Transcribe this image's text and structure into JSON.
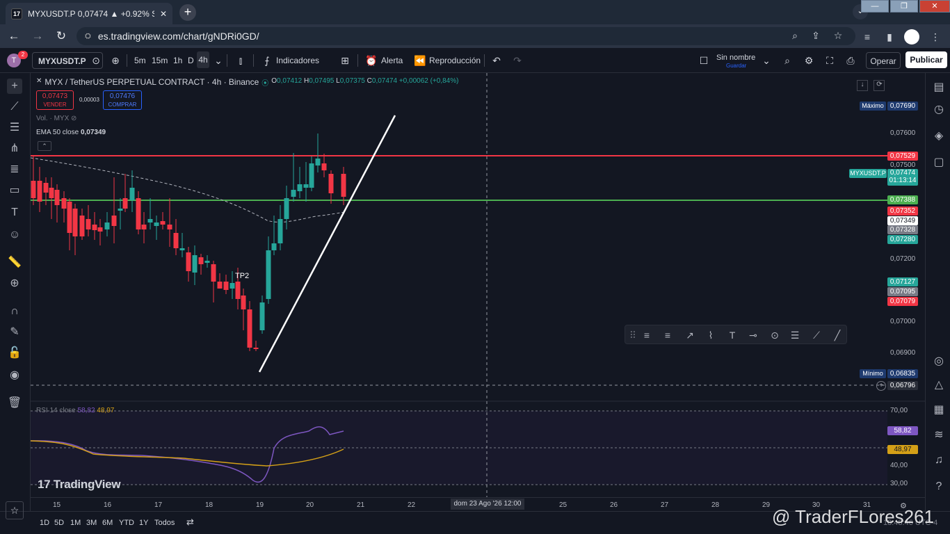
{
  "browser": {
    "tab_title": "MYXUSDT.P 0,07474 ▲ +0.92% S",
    "url": "es.tradingview.com/chart/gNDRi0GD/",
    "badge_count": "2"
  },
  "toolbar": {
    "avatar_letter": "T",
    "symbol": "MYXUSDT.P",
    "timeframes": [
      "5m",
      "15m",
      "1h",
      "D",
      "4h"
    ],
    "indicators_label": "Indicadores",
    "alert_label": "Alerta",
    "replay_label": "Reproducción",
    "layout_name": "Sin nombre",
    "save_label": "Guardar",
    "trade_label": "Operar",
    "publish_label": "Publicar"
  },
  "legend": {
    "title": "MYX / TetherUS PERPETUAL CONTRACT · 4h · Binance",
    "o": "0,07412",
    "h": "0,07495",
    "l": "0,07375",
    "c": "0,07474",
    "chg": "+0,00062 (+0,84%)",
    "sell_price": "0,07473",
    "sell_label": "VENDER",
    "buy_price": "0,07476",
    "buy_label": "COMPRAR",
    "spread": "0,00003",
    "vol": "Vol. · MYX",
    "ema": "EMA 50 close",
    "ema_val": "0,07349",
    "rsi": "RSI 14 close",
    "rsi_val1": "58,82",
    "rsi_val2": "48,97"
  },
  "price_axis": {
    "max_label": "Máximo",
    "max_val": "0,07690",
    "ticks": [
      "0,07600",
      "0,07500",
      "0,07200",
      "0,07000",
      "0,06900"
    ],
    "red_line": "0,07529",
    "symbol_tag": "MYXUSDT.P",
    "last": "0,07474",
    "countdown": "01:13:14",
    "green_line": "0,07388",
    "p1": "0,07352",
    "p2": "0,07349",
    "p3": "0,07328",
    "p4": "0,07280",
    "p5": "0,07127",
    "p6": "0,07095",
    "p7": "0,07079",
    "min_label": "Mínimo",
    "min_val": "0,06835",
    "crosshair": "0,06796",
    "rsi_ticks": [
      "70,00",
      "40,00",
      "30,00"
    ],
    "rsi1": "58,82",
    "rsi2": "48,97"
  },
  "time_axis": {
    "labels": [
      "15",
      "16",
      "17",
      "18",
      "19",
      "20",
      "21",
      "22",
      "25",
      "26",
      "27",
      "28",
      "29",
      "30",
      "31"
    ],
    "crosshair": "dom 23 Ago '26   12:00"
  },
  "bottom": {
    "ranges": [
      "1D",
      "5D",
      "1M",
      "3M",
      "6M",
      "YTD",
      "1Y",
      "Todos"
    ],
    "clock": "18:48:46 UTC-4"
  },
  "chart_marks": {
    "tp_label": "TP2",
    "logo": "TradingView"
  },
  "watermark": "@ TraderFLores261",
  "colors": {
    "bg": "#131722",
    "up": "#26a69a",
    "down": "#f23645",
    "red_line": "#f23645",
    "green_line": "#4caf50",
    "ema": "#b2b5be",
    "rsi": "#7e57c2",
    "rsi_ma": "#d4a017"
  },
  "chart_data": {
    "type": "candlestick",
    "timeframe": "4h",
    "candles_ohlc": [
      [
        0.07412,
        0.07495,
        0.07375,
        0.07474
      ]
    ],
    "horizontal_lines": [
      0.07529,
      0.07388
    ],
    "ema50": 0.07349,
    "rsi14": 58.82,
    "rsi_ma": 48.97,
    "y_range": [
      0.06796,
      0.0769
    ]
  }
}
